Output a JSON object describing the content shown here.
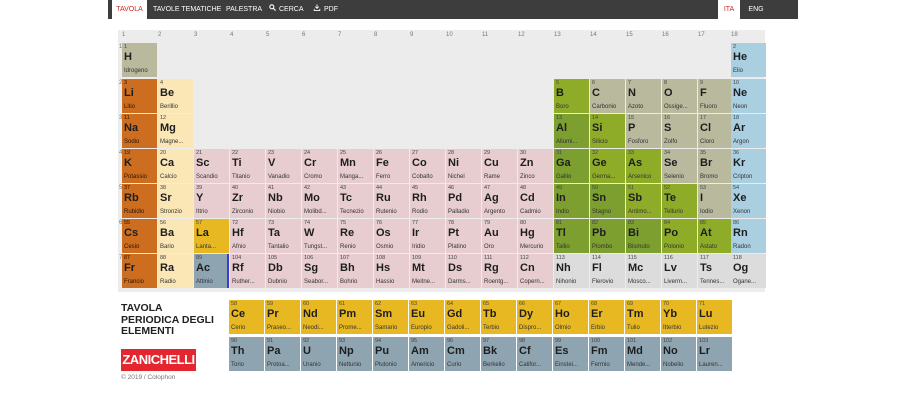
{
  "nav": {
    "tabs": [
      "TAVOLA",
      "TAVOLE TEMATICHE",
      "PALESTRA",
      "CERCA",
      "PDF"
    ],
    "search_icon": "magnifier-icon",
    "pdf_icon": "download-icon",
    "languages": [
      "ITA",
      "ENG"
    ],
    "active_tab": "TAVOLA",
    "active_language": "ITA"
  },
  "group_numbers": [
    "1",
    "2",
    "3",
    "4",
    "5",
    "6",
    "7",
    "8",
    "9",
    "10",
    "11",
    "12",
    "13",
    "14",
    "15",
    "16",
    "17",
    "18"
  ],
  "period_numbers": [
    "1",
    "2",
    "3",
    "4",
    "5",
    "6",
    "7"
  ],
  "category_colors": {
    "alkali": "#cc6d1f",
    "alkaline": "#fbe7b6",
    "transition": "#e7cdd0",
    "lanthanide": "#e8b822",
    "actinide": "#8ea4b1",
    "nonmetal": "#b8b99d",
    "noble": "#a9cfe0",
    "metalloid": "#8eac28",
    "posttrans": "#7c9f2f",
    "unknown": "#dcdcdc"
  },
  "elements": [
    {
      "num": "1",
      "sym": "H",
      "name": "Idrogeno",
      "row": 1,
      "col": 1,
      "cat": "nonmetal"
    },
    {
      "num": "2",
      "sym": "He",
      "name": "Elio",
      "row": 1,
      "col": 18,
      "cat": "noble"
    },
    {
      "num": "3",
      "sym": "Li",
      "name": "Litio",
      "row": 2,
      "col": 1,
      "cat": "alkali"
    },
    {
      "num": "4",
      "sym": "Be",
      "name": "Berillio",
      "row": 2,
      "col": 2,
      "cat": "alkaline"
    },
    {
      "num": "5",
      "sym": "B",
      "name": "Boro",
      "row": 2,
      "col": 13,
      "cat": "metalloid"
    },
    {
      "num": "6",
      "sym": "C",
      "name": "Carbonio",
      "row": 2,
      "col": 14,
      "cat": "nonmetal"
    },
    {
      "num": "7",
      "sym": "N",
      "name": "Azoto",
      "row": 2,
      "col": 15,
      "cat": "nonmetal"
    },
    {
      "num": "8",
      "sym": "O",
      "name": "Ossige...",
      "row": 2,
      "col": 16,
      "cat": "nonmetal"
    },
    {
      "num": "9",
      "sym": "F",
      "name": "Fluoro",
      "row": 2,
      "col": 17,
      "cat": "nonmetal"
    },
    {
      "num": "10",
      "sym": "Ne",
      "name": "Neon",
      "row": 2,
      "col": 18,
      "cat": "noble"
    },
    {
      "num": "11",
      "sym": "Na",
      "name": "Sodio",
      "row": 3,
      "col": 1,
      "cat": "alkali"
    },
    {
      "num": "12",
      "sym": "Mg",
      "name": "Magne...",
      "row": 3,
      "col": 2,
      "cat": "alkaline"
    },
    {
      "num": "13",
      "sym": "Al",
      "name": "Allumi...",
      "row": 3,
      "col": 13,
      "cat": "posttrans"
    },
    {
      "num": "14",
      "sym": "Si",
      "name": "Silicio",
      "row": 3,
      "col": 14,
      "cat": "metalloid"
    },
    {
      "num": "15",
      "sym": "P",
      "name": "Fosforo",
      "row": 3,
      "col": 15,
      "cat": "nonmetal"
    },
    {
      "num": "16",
      "sym": "S",
      "name": "Zolfo",
      "row": 3,
      "col": 16,
      "cat": "nonmetal"
    },
    {
      "num": "17",
      "sym": "Cl",
      "name": "Cloro",
      "row": 3,
      "col": 17,
      "cat": "nonmetal"
    },
    {
      "num": "18",
      "sym": "Ar",
      "name": "Argon",
      "row": 3,
      "col": 18,
      "cat": "noble"
    },
    {
      "num": "19",
      "sym": "K",
      "name": "Potassio",
      "row": 4,
      "col": 1,
      "cat": "alkali"
    },
    {
      "num": "20",
      "sym": "Ca",
      "name": "Calcio",
      "row": 4,
      "col": 2,
      "cat": "alkaline"
    },
    {
      "num": "21",
      "sym": "Sc",
      "name": "Scandio",
      "row": 4,
      "col": 3,
      "cat": "transition"
    },
    {
      "num": "22",
      "sym": "Ti",
      "name": "Titanio",
      "row": 4,
      "col": 4,
      "cat": "transition"
    },
    {
      "num": "23",
      "sym": "V",
      "name": "Vanadio",
      "row": 4,
      "col": 5,
      "cat": "transition"
    },
    {
      "num": "24",
      "sym": "Cr",
      "name": "Cromo",
      "row": 4,
      "col": 6,
      "cat": "transition"
    },
    {
      "num": "25",
      "sym": "Mn",
      "name": "Manga...",
      "row": 4,
      "col": 7,
      "cat": "transition"
    },
    {
      "num": "26",
      "sym": "Fe",
      "name": "Ferro",
      "row": 4,
      "col": 8,
      "cat": "transition"
    },
    {
      "num": "27",
      "sym": "Co",
      "name": "Cobalto",
      "row": 4,
      "col": 9,
      "cat": "transition"
    },
    {
      "num": "28",
      "sym": "Ni",
      "name": "Nichel",
      "row": 4,
      "col": 10,
      "cat": "transition"
    },
    {
      "num": "29",
      "sym": "Cu",
      "name": "Rame",
      "row": 4,
      "col": 11,
      "cat": "transition"
    },
    {
      "num": "30",
      "sym": "Zn",
      "name": "Zinco",
      "row": 4,
      "col": 12,
      "cat": "transition"
    },
    {
      "num": "31",
      "sym": "Ga",
      "name": "Gallio",
      "row": 4,
      "col": 13,
      "cat": "posttrans"
    },
    {
      "num": "32",
      "sym": "Ge",
      "name": "Germa...",
      "row": 4,
      "col": 14,
      "cat": "metalloid"
    },
    {
      "num": "33",
      "sym": "As",
      "name": "Arsenico",
      "row": 4,
      "col": 15,
      "cat": "metalloid"
    },
    {
      "num": "34",
      "sym": "Se",
      "name": "Selenio",
      "row": 4,
      "col": 16,
      "cat": "nonmetal"
    },
    {
      "num": "35",
      "sym": "Br",
      "name": "Bromo",
      "row": 4,
      "col": 17,
      "cat": "nonmetal"
    },
    {
      "num": "36",
      "sym": "Kr",
      "name": "Cripton",
      "row": 4,
      "col": 18,
      "cat": "noble"
    },
    {
      "num": "37",
      "sym": "Rb",
      "name": "Rubidio",
      "row": 5,
      "col": 1,
      "cat": "alkali"
    },
    {
      "num": "38",
      "sym": "Sr",
      "name": "Stronzio",
      "row": 5,
      "col": 2,
      "cat": "alkaline"
    },
    {
      "num": "39",
      "sym": "Y",
      "name": "Ittrio",
      "row": 5,
      "col": 3,
      "cat": "transition"
    },
    {
      "num": "40",
      "sym": "Zr",
      "name": "Zirconio",
      "row": 5,
      "col": 4,
      "cat": "transition"
    },
    {
      "num": "41",
      "sym": "Nb",
      "name": "Niobio",
      "row": 5,
      "col": 5,
      "cat": "transition"
    },
    {
      "num": "42",
      "sym": "Mo",
      "name": "Molibd...",
      "row": 5,
      "col": 6,
      "cat": "transition"
    },
    {
      "num": "43",
      "sym": "Tc",
      "name": "Tecnezio",
      "row": 5,
      "col": 7,
      "cat": "transition"
    },
    {
      "num": "44",
      "sym": "Ru",
      "name": "Rutenio",
      "row": 5,
      "col": 8,
      "cat": "transition"
    },
    {
      "num": "45",
      "sym": "Rh",
      "name": "Rodio",
      "row": 5,
      "col": 9,
      "cat": "transition"
    },
    {
      "num": "46",
      "sym": "Pd",
      "name": "Palladio",
      "row": 5,
      "col": 10,
      "cat": "transition"
    },
    {
      "num": "47",
      "sym": "Ag",
      "name": "Argento",
      "row": 5,
      "col": 11,
      "cat": "transition"
    },
    {
      "num": "48",
      "sym": "Cd",
      "name": "Cadmio",
      "row": 5,
      "col": 12,
      "cat": "transition"
    },
    {
      "num": "49",
      "sym": "In",
      "name": "Indio",
      "row": 5,
      "col": 13,
      "cat": "posttrans"
    },
    {
      "num": "50",
      "sym": "Sn",
      "name": "Stagno",
      "row": 5,
      "col": 14,
      "cat": "posttrans"
    },
    {
      "num": "51",
      "sym": "Sb",
      "name": "Antimo...",
      "row": 5,
      "col": 15,
      "cat": "metalloid"
    },
    {
      "num": "52",
      "sym": "Te",
      "name": "Tellurio",
      "row": 5,
      "col": 16,
      "cat": "metalloid"
    },
    {
      "num": "53",
      "sym": "I",
      "name": "Iodio",
      "row": 5,
      "col": 17,
      "cat": "nonmetal"
    },
    {
      "num": "54",
      "sym": "Xe",
      "name": "Xenon",
      "row": 5,
      "col": 18,
      "cat": "noble"
    },
    {
      "num": "55",
      "sym": "Cs",
      "name": "Cesio",
      "row": 6,
      "col": 1,
      "cat": "alkali"
    },
    {
      "num": "56",
      "sym": "Ba",
      "name": "Bario",
      "row": 6,
      "col": 2,
      "cat": "alkaline"
    },
    {
      "num": "57",
      "sym": "La",
      "name": "Lanta...",
      "row": 6,
      "col": 3,
      "cat": "lanthanide"
    },
    {
      "num": "72",
      "sym": "Hf",
      "name": "Afnio",
      "row": 6,
      "col": 4,
      "cat": "transition"
    },
    {
      "num": "73",
      "sym": "Ta",
      "name": "Tantalio",
      "row": 6,
      "col": 5,
      "cat": "transition"
    },
    {
      "num": "74",
      "sym": "W",
      "name": "Tungst...",
      "row": 6,
      "col": 6,
      "cat": "transition"
    },
    {
      "num": "75",
      "sym": "Re",
      "name": "Renio",
      "row": 6,
      "col": 7,
      "cat": "transition"
    },
    {
      "num": "76",
      "sym": "Os",
      "name": "Osmio",
      "row": 6,
      "col": 8,
      "cat": "transition"
    },
    {
      "num": "77",
      "sym": "Ir",
      "name": "Iridio",
      "row": 6,
      "col": 9,
      "cat": "transition"
    },
    {
      "num": "78",
      "sym": "Pt",
      "name": "Platino",
      "row": 6,
      "col": 10,
      "cat": "transition"
    },
    {
      "num": "79",
      "sym": "Au",
      "name": "Oro",
      "row": 6,
      "col": 11,
      "cat": "transition"
    },
    {
      "num": "80",
      "sym": "Hg",
      "name": "Mercurio",
      "row": 6,
      "col": 12,
      "cat": "transition"
    },
    {
      "num": "81",
      "sym": "Tl",
      "name": "Tallio",
      "row": 6,
      "col": 13,
      "cat": "posttrans"
    },
    {
      "num": "82",
      "sym": "Pb",
      "name": "Piombo",
      "row": 6,
      "col": 14,
      "cat": "posttrans"
    },
    {
      "num": "83",
      "sym": "Bi",
      "name": "Bismuto",
      "row": 6,
      "col": 15,
      "cat": "posttrans"
    },
    {
      "num": "84",
      "sym": "Po",
      "name": "Polonio",
      "row": 6,
      "col": 16,
      "cat": "metalloid"
    },
    {
      "num": "85",
      "sym": "At",
      "name": "Astato",
      "row": 6,
      "col": 17,
      "cat": "metalloid"
    },
    {
      "num": "86",
      "sym": "Rn",
      "name": "Radon",
      "row": 6,
      "col": 18,
      "cat": "noble"
    },
    {
      "num": "87",
      "sym": "Fr",
      "name": "Francio",
      "row": 7,
      "col": 1,
      "cat": "alkali"
    },
    {
      "num": "88",
      "sym": "Ra",
      "name": "Radio",
      "row": 7,
      "col": 2,
      "cat": "alkaline"
    },
    {
      "num": "89",
      "sym": "Ac",
      "name": "Attinio",
      "row": 7,
      "col": 3,
      "cat": "actinide"
    },
    {
      "num": "104",
      "sym": "Rf",
      "name": "Ruther...",
      "row": 7,
      "col": 4,
      "cat": "transition"
    },
    {
      "num": "105",
      "sym": "Db",
      "name": "Dubnio",
      "row": 7,
      "col": 5,
      "cat": "transition"
    },
    {
      "num": "106",
      "sym": "Sg",
      "name": "Seabor...",
      "row": 7,
      "col": 6,
      "cat": "transition"
    },
    {
      "num": "107",
      "sym": "Bh",
      "name": "Bohrio",
      "row": 7,
      "col": 7,
      "cat": "transition"
    },
    {
      "num": "108",
      "sym": "Hs",
      "name": "Hassio",
      "row": 7,
      "col": 8,
      "cat": "transition"
    },
    {
      "num": "109",
      "sym": "Mt",
      "name": "Meitne...",
      "row": 7,
      "col": 9,
      "cat": "transition"
    },
    {
      "num": "110",
      "sym": "Ds",
      "name": "Darms...",
      "row": 7,
      "col": 10,
      "cat": "transition"
    },
    {
      "num": "111",
      "sym": "Rg",
      "name": "Roentg...",
      "row": 7,
      "col": 11,
      "cat": "transition"
    },
    {
      "num": "112",
      "sym": "Cn",
      "name": "Copern...",
      "row": 7,
      "col": 12,
      "cat": "transition"
    },
    {
      "num": "113",
      "sym": "Nh",
      "name": "Nihonio",
      "row": 7,
      "col": 13,
      "cat": "unknown"
    },
    {
      "num": "114",
      "sym": "Fl",
      "name": "Flerovio",
      "row": 7,
      "col": 14,
      "cat": "unknown"
    },
    {
      "num": "115",
      "sym": "Mc",
      "name": "Mosco...",
      "row": 7,
      "col": 15,
      "cat": "unknown"
    },
    {
      "num": "116",
      "sym": "Lv",
      "name": "Liverm...",
      "row": 7,
      "col": 16,
      "cat": "unknown"
    },
    {
      "num": "117",
      "sym": "Ts",
      "name": "Tennes...",
      "row": 7,
      "col": 17,
      "cat": "unknown"
    },
    {
      "num": "118",
      "sym": "Og",
      "name": "Ogane...",
      "row": 7,
      "col": 18,
      "cat": "unknown"
    }
  ],
  "f_block": {
    "lanthanides": [
      {
        "num": "58",
        "sym": "Ce",
        "name": "Cerio"
      },
      {
        "num": "59",
        "sym": "Pr",
        "name": "Praseo..."
      },
      {
        "num": "60",
        "sym": "Nd",
        "name": "Neodi..."
      },
      {
        "num": "61",
        "sym": "Pm",
        "name": "Prome..."
      },
      {
        "num": "62",
        "sym": "Sm",
        "name": "Samario"
      },
      {
        "num": "63",
        "sym": "Eu",
        "name": "Europio"
      },
      {
        "num": "64",
        "sym": "Gd",
        "name": "Gadoli..."
      },
      {
        "num": "65",
        "sym": "Tb",
        "name": "Terbio"
      },
      {
        "num": "66",
        "sym": "Dy",
        "name": "Dispro..."
      },
      {
        "num": "67",
        "sym": "Ho",
        "name": "Olmio"
      },
      {
        "num": "68",
        "sym": "Er",
        "name": "Erbio"
      },
      {
        "num": "69",
        "sym": "Tm",
        "name": "Tulio"
      },
      {
        "num": "70",
        "sym": "Yb",
        "name": "Itterbio"
      },
      {
        "num": "71",
        "sym": "Lu",
        "name": "Lutezio"
      }
    ],
    "actinides": [
      {
        "num": "90",
        "sym": "Th",
        "name": "Torio"
      },
      {
        "num": "91",
        "sym": "Pa",
        "name": "Protoa..."
      },
      {
        "num": "92",
        "sym": "U",
        "name": "Uranio"
      },
      {
        "num": "93",
        "sym": "Np",
        "name": "Nettunio"
      },
      {
        "num": "94",
        "sym": "Pu",
        "name": "Plutonio"
      },
      {
        "num": "95",
        "sym": "Am",
        "name": "Americio"
      },
      {
        "num": "96",
        "sym": "Cm",
        "name": "Curio"
      },
      {
        "num": "97",
        "sym": "Bk",
        "name": "Berkelio"
      },
      {
        "num": "98",
        "sym": "Cf",
        "name": "Califor..."
      },
      {
        "num": "99",
        "sym": "Es",
        "name": "Einstei..."
      },
      {
        "num": "100",
        "sym": "Fm",
        "name": "Fermio"
      },
      {
        "num": "101",
        "sym": "Md",
        "name": "Mende..."
      },
      {
        "num": "102",
        "sym": "No",
        "name": "Nobelio"
      },
      {
        "num": "103",
        "sym": "Lr",
        "name": "Lauren..."
      }
    ]
  },
  "brand": {
    "title": "TAVOLA\nPERIODICA DEGLI\nELEMENTI",
    "logo": "ZANICHELLI",
    "copyright": "© 2019 / Colophon"
  }
}
